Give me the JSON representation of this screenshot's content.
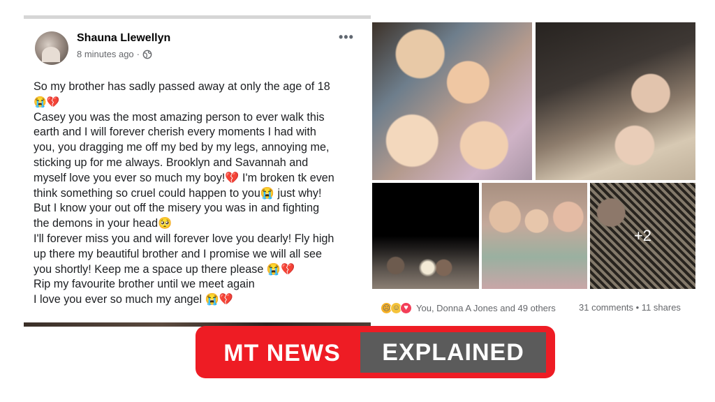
{
  "post": {
    "author": "Shauna Llewellyn",
    "time": "8 minutes ago",
    "privacy_icon": "globe-icon",
    "menu_icon": "more-options-icon",
    "lines": [
      "So my brother has sadly passed away at only the age of 18",
      "😭💔",
      "Casey you was the most amazing person to ever walk this",
      "earth and I will forever cherish every moments I had with",
      "you, you dragging me off my bed by my legs, annoying me,",
      "sticking up for me always. Brooklyn and Savannah and",
      "myself love you ever so much my boy!💔 I'm broken tk even",
      "think something so cruel could happen to you😭 just why!",
      "But I know your out off the misery you was in and fighting",
      "the demons in your head🥺",
      "I'll forever miss you and will forever love you dearly! Fly high",
      "up there my beautiful brother and I promise we will all see",
      "you shortly! Keep me a space up there please 😭💔",
      "Rip my favourite brother until we meet again",
      "I love you ever so much my angel 😭💔"
    ]
  },
  "photos": {
    "more_count": "+2"
  },
  "reactions": {
    "icons": [
      "sad-reaction-icon",
      "care-reaction-icon",
      "love-reaction-icon"
    ],
    "summary": "You, Donna A Jones and 49 others",
    "comments_shares": "31 comments • 11 shares"
  },
  "banner": {
    "left_text": "MT NEWS",
    "right_text": "EXPLAINED",
    "colors": {
      "red": "#ee1c24",
      "grey": "#5b5b5b"
    }
  }
}
